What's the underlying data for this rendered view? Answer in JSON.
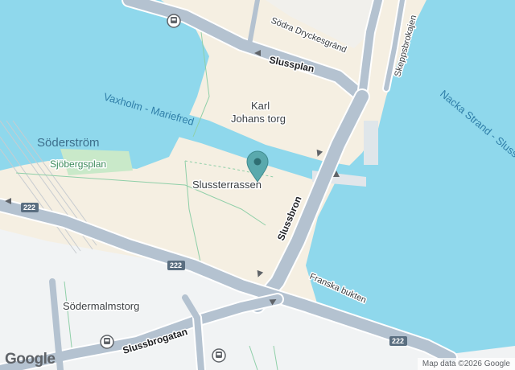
{
  "colors": {
    "water": "#8fd8ec",
    "land": "#f5efe2",
    "urban": "#f1f3f4",
    "park": "#c9e9c9",
    "road": "#b4c2d0",
    "road_edge": "#ffffff",
    "route_badge": "#5a6e80",
    "pin": "#5aa9ad"
  },
  "labels": {
    "vaxholm_route": "Vaxholm - Mariefred",
    "nacka_route": "Nacka Strand - Slussen",
    "soderstrom": "Söderström",
    "sjobergsplan": "Sjöbergsplan",
    "karl_line1": "Karl",
    "karl_line2": "Johans torg",
    "slussterrassen": "Slussterrassen",
    "slussplan": "Slussplan",
    "sodra_dryckesgrand": "Södra Dryckesgränd",
    "skeppsbrokajen": "Skeppsbrokajen",
    "slussbron": "Slussbron",
    "franska_bukten": "Franska bukten",
    "sodermalmstorg": "Södermalmstorg",
    "slussbrogatan": "Slussbrogatan"
  },
  "route_numbers": [
    "222",
    "222",
    "222"
  ],
  "icons": [
    "metro-station-icon",
    "metro-station-icon",
    "metro-station-icon",
    "location-pin-icon",
    "one-way-arrow-icon"
  ],
  "branding": {
    "logo": "Google",
    "attribution": "Map data ©2026 Google"
  }
}
